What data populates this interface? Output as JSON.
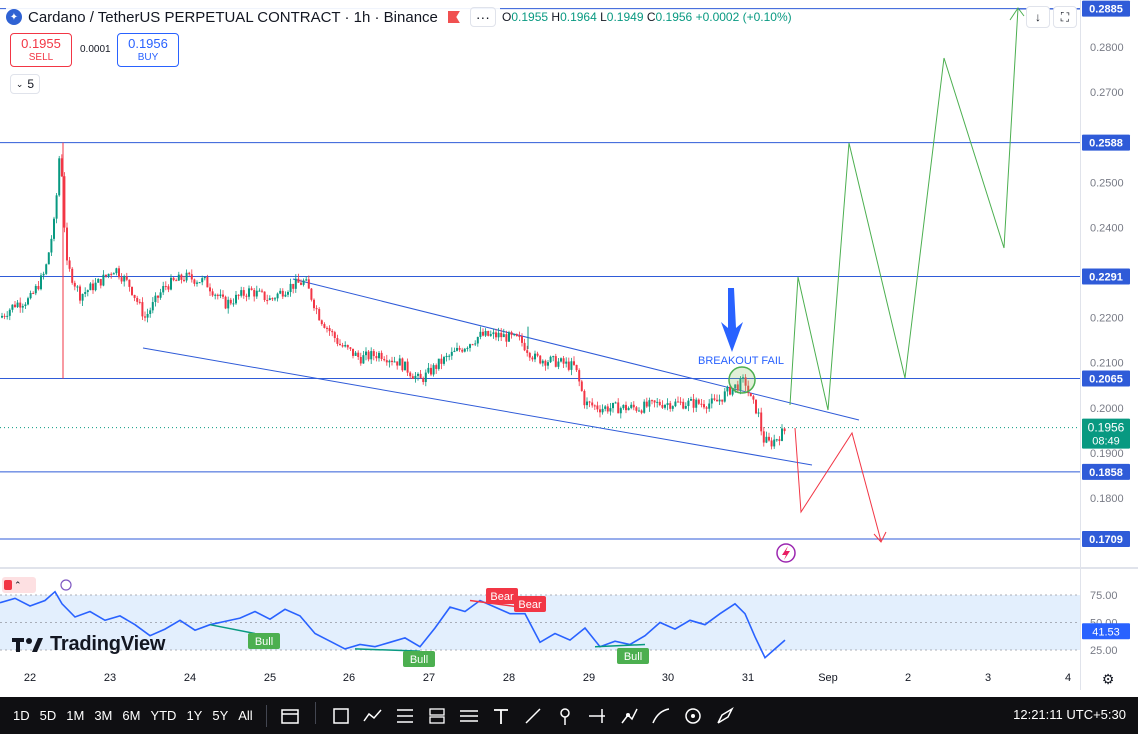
{
  "header": {
    "title": "Cardano / TetherUS PERPETUAL CONTRACT · 1h · Binance",
    "more_glyph": "···",
    "ohlc": {
      "o_label": "O",
      "o": "0.1955",
      "h_label": "H",
      "h": "0.1964",
      "l_label": "L",
      "l": "0.1949",
      "c_label": "C",
      "c": "0.1956",
      "change": "+0.0002 (+0.10%)"
    }
  },
  "trade": {
    "sell_price": "0.1955",
    "sell_label": "SELL",
    "spread": "0.0001",
    "buy_price": "0.1956",
    "buy_label": "BUY"
  },
  "interval": {
    "value": "5"
  },
  "price_axis": {
    "ticks": [
      "0.2800",
      "0.2700",
      "0.2500",
      "0.2400",
      "0.2200",
      "0.2100",
      "0.2000",
      "0.1900",
      "0.1800"
    ],
    "level_labels": [
      "0.2885",
      "0.2588",
      "0.2291",
      "0.2065",
      "0.1858",
      "0.1709"
    ],
    "current_price": "0.1956",
    "countdown": "08:49"
  },
  "annotations": {
    "breakout_text": "BREAKOUT FAIL"
  },
  "rsi": {
    "ticks": [
      "75.00",
      "50.00",
      "25.00"
    ],
    "current": "41.53",
    "labels": [
      {
        "text": "Bull",
        "type": "bull"
      },
      {
        "text": "Bull",
        "type": "bull"
      },
      {
        "text": "Bull",
        "type": "bull"
      },
      {
        "text": "Bear",
        "type": "bear"
      },
      {
        "text": "Bear",
        "type": "bear"
      }
    ]
  },
  "time_axis": [
    "22",
    "23",
    "24",
    "25",
    "26",
    "27",
    "28",
    "29",
    "30",
    "31",
    "Sep",
    "2",
    "3",
    "4"
  ],
  "branding": {
    "logo_text": "TradingView"
  },
  "toolbar": {
    "periods": [
      "1D",
      "5D",
      "1M",
      "3M",
      "6M",
      "YTD",
      "1Y",
      "5Y",
      "All"
    ],
    "clock": "12:21:11 UTC+5:30",
    "tools": [
      "calendar-range-icon",
      "rectangle-icon",
      "path-icon",
      "fib-levels-icon",
      "long-short-icon",
      "parallel-lines-icon",
      "text-icon",
      "trend-line-icon",
      "pin-icon",
      "pitchfork-icon",
      "node-path-icon",
      "brush-icon",
      "eye-icon",
      "pen-icon"
    ]
  },
  "colors": {
    "up": "#089981",
    "down": "#f23645",
    "blue": "#2962ff",
    "line_blue": "#2f5bd8",
    "proj_green": "#4caf50",
    "proj_red": "#f23645",
    "rsi_line": "#2962ff",
    "rsi_band": "#e3effd"
  }
}
